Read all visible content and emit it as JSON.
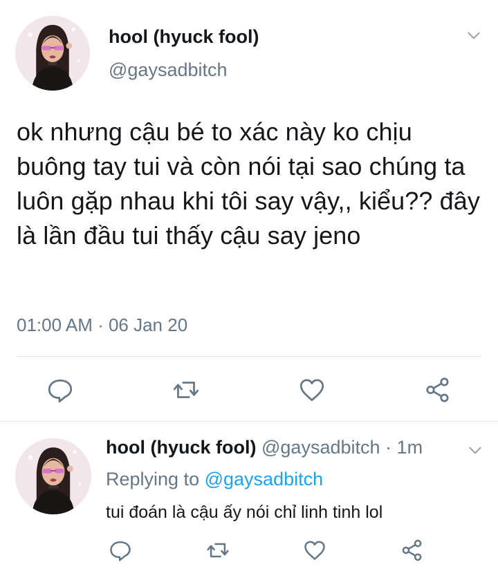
{
  "main_tweet": {
    "display_name": "hool (hyuck fool)",
    "handle": "@gaysadbitch",
    "text": "ok nhưng cậu bé to xác này ko chịu buông tay tui và còn nói tại sao chúng ta luôn gặp nhau khi tôi say vậy,, kiểu?? đây là lần đầu tui thấy cậu say jeno",
    "timestamp": "01:00 AM · 06 Jan 20",
    "actions": {
      "reply_icon": "speech-bubble-icon",
      "retweet_icon": "retweet-icon",
      "like_icon": "heart-icon",
      "share_icon": "share-icon"
    }
  },
  "reply_tweet": {
    "display_name": "hool (hyuck fool)",
    "handle": "@gaysadbitch",
    "separator": "·",
    "time_ago": "1m",
    "replying_to_label": "Replying to",
    "replying_to_handle": "@gaysadbitch",
    "text": "tui đoán là cậu ấy nói chỉ linh tinh lol"
  },
  "colors": {
    "text_primary": "#14171a",
    "text_secondary": "#657786",
    "link": "#1da1f2",
    "divider": "#e1e8ed",
    "icon": "#657786"
  }
}
